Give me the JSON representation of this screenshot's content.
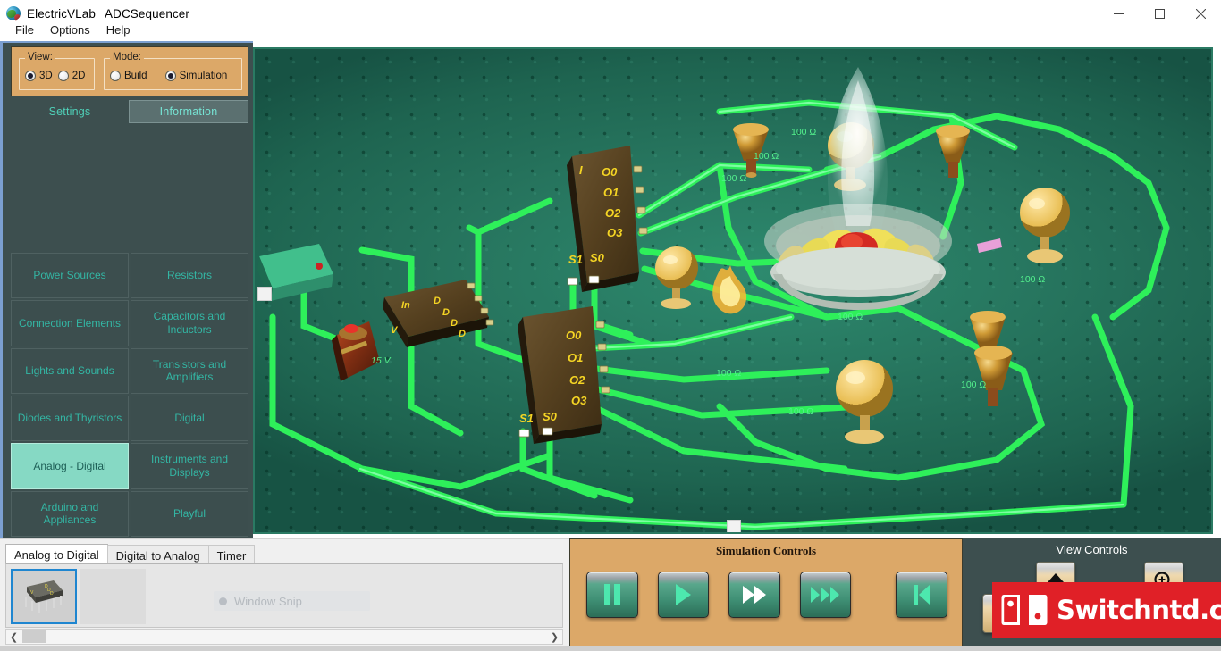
{
  "window": {
    "app_name": "ElectricVLab",
    "document_name": "ADCSequencer",
    "icon": "globe-icon",
    "controls": {
      "minimize": "minimize-icon",
      "maximize": "maximize-icon",
      "close": "close-icon"
    }
  },
  "menubar": {
    "items": [
      "File",
      "Options",
      "Help"
    ]
  },
  "left_panel": {
    "view_group": {
      "legend": "View:",
      "options": [
        {
          "label": "3D",
          "selected": true
        },
        {
          "label": "2D",
          "selected": false
        }
      ]
    },
    "mode_group": {
      "legend": "Mode:",
      "options": [
        {
          "label": "Build",
          "selected": false
        },
        {
          "label": "Simulation",
          "selected": true
        }
      ]
    },
    "tabs": [
      {
        "label": "Settings",
        "active": false
      },
      {
        "label": "Information",
        "active": true
      }
    ],
    "categories": [
      {
        "label": "Power Sources",
        "selected": false
      },
      {
        "label": "Resistors",
        "selected": false
      },
      {
        "label": "Connection Elements",
        "selected": false
      },
      {
        "label": "Capacitors and Inductors",
        "selected": false
      },
      {
        "label": "Lights and Sounds",
        "selected": false
      },
      {
        "label": "Transistors and Amplifiers",
        "selected": false
      },
      {
        "label": "Diodes and Thyristors",
        "selected": false
      },
      {
        "label": "Digital",
        "selected": false
      },
      {
        "label": "Analog - Digital",
        "selected": true
      },
      {
        "label": "Instruments and Displays",
        "selected": false
      },
      {
        "label": "Arduino and Appliances",
        "selected": false
      },
      {
        "label": "Playful",
        "selected": false
      }
    ]
  },
  "viewport": {
    "chip_adc": {
      "labels_left": [
        "In",
        "V"
      ],
      "labels_right": [
        "D",
        "D",
        "D",
        "D"
      ]
    },
    "chip_top": {
      "input": "I",
      "outputs": [
        "O0",
        "O1",
        "O2",
        "O3"
      ],
      "selects": [
        "S1",
        "S0"
      ]
    },
    "chip_bottom": {
      "outputs": [
        "O0",
        "O1",
        "O2",
        "O3"
      ],
      "selects": [
        "S1",
        "S0"
      ]
    },
    "battery_label": "15 V",
    "resistor_labels": [
      "100 Ω",
      "100 Ω",
      "100 Ω",
      "100 Ω",
      "100 Ω",
      "100 Ω",
      "100 Ω",
      "100 Ω"
    ]
  },
  "bottom_panel": {
    "tabs": [
      {
        "label": "Analog to Digital",
        "active": true
      },
      {
        "label": "Digital to Analog",
        "active": false
      },
      {
        "label": "Timer",
        "active": false
      }
    ],
    "snip_overlay": {
      "label": "Window Snip"
    },
    "scroll": {
      "left_arrow": "chevron-left-icon",
      "right_arrow": "chevron-right-icon"
    }
  },
  "simulation_controls": {
    "title": "Simulation Controls",
    "buttons": [
      {
        "name": "pause-button",
        "icon": "pause-icon"
      },
      {
        "name": "play-button",
        "icon": "play-icon"
      },
      {
        "name": "fast-forward-button",
        "icon": "fast-forward-icon"
      },
      {
        "name": "very-fast-forward-button",
        "icon": "triple-forward-icon"
      },
      {
        "name": "restart-button",
        "icon": "skip-back-icon"
      }
    ]
  },
  "view_controls": {
    "title": "View Controls",
    "buttons": [
      {
        "name": "pan-up-button",
        "icon": "arrow-up-icon"
      },
      {
        "name": "zoom-in-button",
        "icon": "magnifier-plus-icon"
      },
      {
        "name": "pan-left-button",
        "icon": "arrow-left-icon"
      },
      {
        "name": "pan-down-button",
        "icon": "arrow-down-icon"
      }
    ]
  },
  "watermark": {
    "text": "Switchntd.com",
    "color": "#e02027"
  },
  "colors": {
    "amber_panel": "#dca868",
    "dark_teal_panel": "#3d4f4f",
    "accent_teal": "#33b6a4",
    "selected_teal": "#86d9c4",
    "board_green": "#27765f",
    "wire_green": "#2ef05a",
    "chip_yellow": "#f5d524"
  }
}
